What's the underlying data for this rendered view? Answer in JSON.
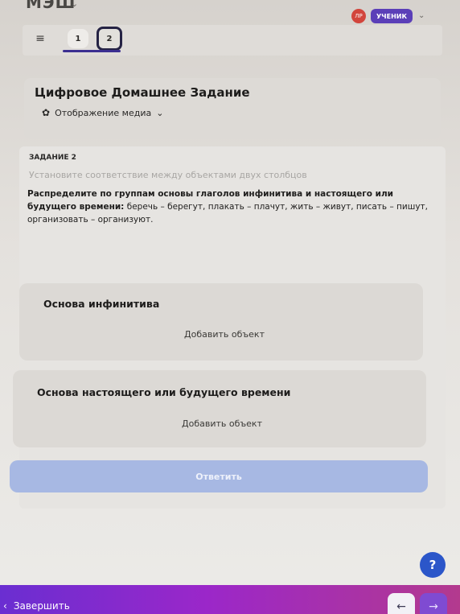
{
  "topbar": {
    "brand": "МЭШ",
    "avatar_initials": "ЛР",
    "role": "УЧЕНИК"
  },
  "tabs": [
    {
      "label": "1"
    },
    {
      "label": "2"
    }
  ],
  "header": {
    "title": "Цифровое Домашнее Задание",
    "media_label": "Отображение медиа"
  },
  "task": {
    "label": "ЗАДАНИЕ 2",
    "subtitle": "Установите соответствие между объектами двух столбцов",
    "instruction_bold": "Распределите по группам основы глаголов инфинитива и настоящего или будущего времени:",
    "instruction_rest": " беречь – берегут, плакать – плачут, жить – живут, писать – пишут, организовать – организуют."
  },
  "groups": [
    {
      "title": "Основа инфинитива",
      "add_label": "Добавить объект"
    },
    {
      "title": "Основа настоящего или будущего времени",
      "add_label": "Добавить объект"
    }
  ],
  "answer_label": "Ответить",
  "help_label": "?",
  "bottom": {
    "finish_label": "Завершить",
    "prev": "←",
    "next": "→"
  },
  "colors": {
    "accent": "#5b3fb8",
    "answer_button": "#a7b8e3",
    "help": "#2b56c9"
  }
}
